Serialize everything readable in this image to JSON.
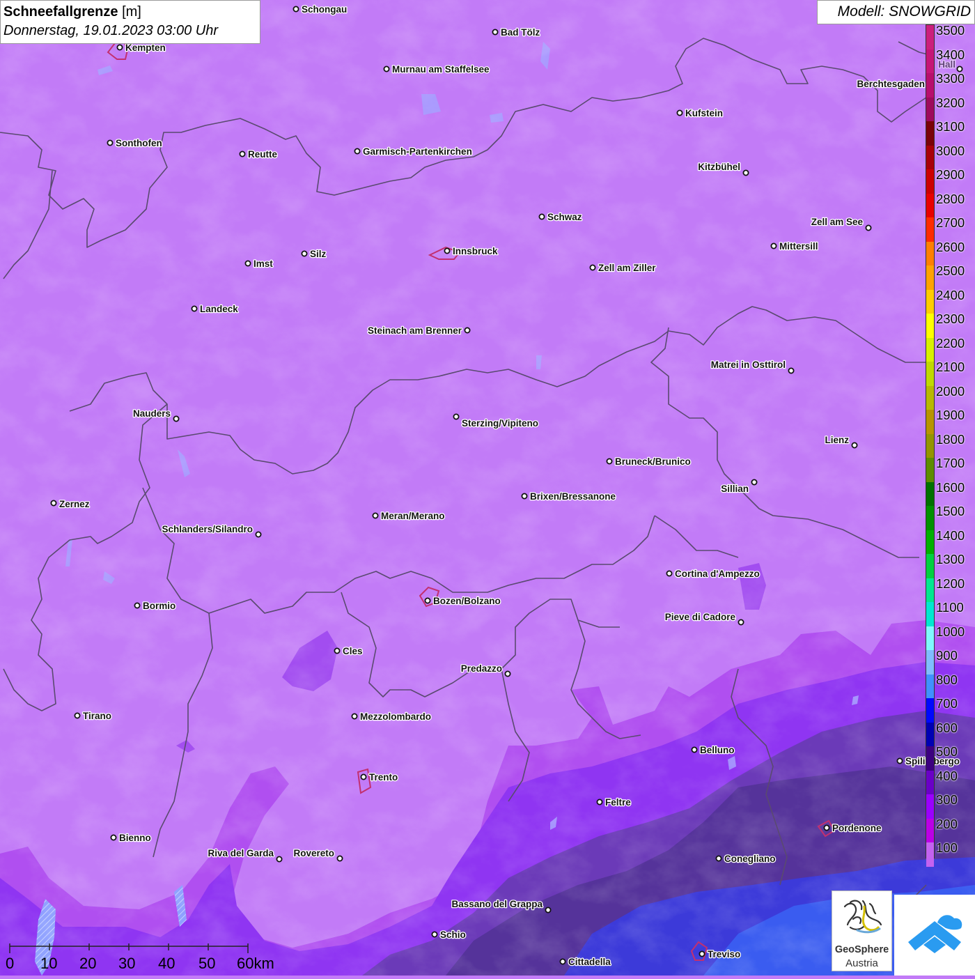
{
  "header": {
    "title_bold": "Schneefallgrenze",
    "title_unit": "[m]",
    "datetime": "Donnerstag, 19.01.2023 03:00 Uhr",
    "model": "Modell: SNOWGRID"
  },
  "legend": {
    "unit": "m",
    "levels": [
      {
        "value": "3500",
        "color": "#cc1f7d"
      },
      {
        "value": "3400",
        "color": "#c61577"
      },
      {
        "value": "3300",
        "color": "#b80e6d"
      },
      {
        "value": "3200",
        "color": "#9e0a5c"
      },
      {
        "value": "3100",
        "color": "#7a0208"
      },
      {
        "value": "3000",
        "color": "#a80008"
      },
      {
        "value": "2900",
        "color": "#cc0000"
      },
      {
        "value": "2800",
        "color": "#e80000"
      },
      {
        "value": "2700",
        "color": "#ff2b00"
      },
      {
        "value": "2600",
        "color": "#ff7f00"
      },
      {
        "value": "2500",
        "color": "#ffa200"
      },
      {
        "value": "2400",
        "color": "#ffcc00"
      },
      {
        "value": "2300",
        "color": "#ffff00"
      },
      {
        "value": "2200",
        "color": "#d8f000"
      },
      {
        "value": "2100",
        "color": "#c0d800"
      },
      {
        "value": "2000",
        "color": "#b8b800"
      },
      {
        "value": "1900",
        "color": "#b89400"
      },
      {
        "value": "1800",
        "color": "#949400"
      },
      {
        "value": "1700",
        "color": "#5e8c00"
      },
      {
        "value": "1600",
        "color": "#007000"
      },
      {
        "value": "1500",
        "color": "#009000"
      },
      {
        "value": "1400",
        "color": "#00b000"
      },
      {
        "value": "1300",
        "color": "#00d040"
      },
      {
        "value": "1200",
        "color": "#00e890"
      },
      {
        "value": "1100",
        "color": "#00e8d0"
      },
      {
        "value": "1000",
        "color": "#80f8ff"
      },
      {
        "value": "900",
        "color": "#80bcff"
      },
      {
        "value": "800",
        "color": "#4090ff"
      },
      {
        "value": "700",
        "color": "#0008ff"
      },
      {
        "value": "600",
        "color": "#0000b4"
      },
      {
        "value": "500",
        "color": "#3c0080"
      },
      {
        "value": "400",
        "color": "#6a00c8"
      },
      {
        "value": "300",
        "color": "#9a00ff"
      },
      {
        "value": "200",
        "color": "#bb00e6"
      },
      {
        "value": "100",
        "color": "#c462f0"
      }
    ]
  },
  "cities": [
    {
      "name": "Schongau"
    },
    {
      "name": "Bad Tölz"
    },
    {
      "name": "Kempten"
    },
    {
      "name": "Murnau am Staffelsee"
    },
    {
      "name": "Berchtesgaden"
    },
    {
      "name": "Kufstein"
    },
    {
      "name": "Sonthofen"
    },
    {
      "name": "Reutte"
    },
    {
      "name": "Garmisch-Partenkirchen"
    },
    {
      "name": "Kitzbühel"
    },
    {
      "name": "Schwaz"
    },
    {
      "name": "Zell am See"
    },
    {
      "name": "Innsbruck"
    },
    {
      "name": "Mittersill"
    },
    {
      "name": "Silz"
    },
    {
      "name": "Imst"
    },
    {
      "name": "Zell am Ziller"
    },
    {
      "name": "Landeck"
    },
    {
      "name": "Steinach am Brenner"
    },
    {
      "name": "Matrei in Osttirol"
    },
    {
      "name": "Nauders"
    },
    {
      "name": "Sterzing/Vipiteno"
    },
    {
      "name": "Lienz"
    },
    {
      "name": "Bruneck/Brunico"
    },
    {
      "name": "Sillian"
    },
    {
      "name": "Brixen/Bressanone"
    },
    {
      "name": "Zernez"
    },
    {
      "name": "Meran/Merano"
    },
    {
      "name": "Schlanders/Silandro"
    },
    {
      "name": "Cortina d'Ampezzo"
    },
    {
      "name": "Bozen/Bolzano"
    },
    {
      "name": "Bormio"
    },
    {
      "name": "Pieve di Cadore"
    },
    {
      "name": "Cles"
    },
    {
      "name": "Predazzo"
    },
    {
      "name": "Tirano"
    },
    {
      "name": "Mezzolombardo"
    },
    {
      "name": "Belluno"
    },
    {
      "name": "Trento"
    },
    {
      "name": "Feltre"
    },
    {
      "name": "Pordenone"
    },
    {
      "name": "Bienno"
    },
    {
      "name": "Riva del Garda"
    },
    {
      "name": "Rovereto"
    },
    {
      "name": "Conegliano"
    },
    {
      "name": "Bassano del Grappa"
    },
    {
      "name": "Schio"
    },
    {
      "name": "Treviso"
    },
    {
      "name": "Cittadella"
    },
    {
      "name": "Spilimbergo"
    },
    {
      "name": "Hallein"
    }
  ],
  "scalebar": {
    "labels": [
      "0",
      "10",
      "20",
      "30",
      "40",
      "50",
      "60km"
    ]
  },
  "logos": {
    "geosphere_line1": "GeoSphere",
    "geosphere_line2": "Austria"
  }
}
